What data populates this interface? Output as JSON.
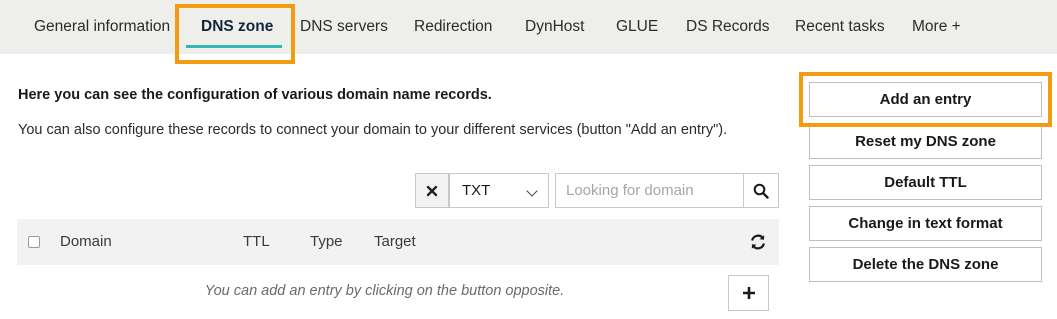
{
  "tabs": [
    {
      "label": "General information"
    },
    {
      "label": "DNS zone",
      "active": true
    },
    {
      "label": "DNS servers"
    },
    {
      "label": "Redirection"
    },
    {
      "label": "DynHost"
    },
    {
      "label": "GLUE"
    },
    {
      "label": "DS Records"
    },
    {
      "label": "Recent tasks"
    },
    {
      "label": "More +"
    }
  ],
  "intro": {
    "title": "Here you can see the configuration of various domain name records.",
    "description": "You can also configure these records to connect your domain to your different services (button \"Add an entry\")."
  },
  "filter": {
    "clear_icon": "close-icon",
    "type_value": "TXT",
    "search_placeholder": "Looking for domain",
    "search_icon": "search-icon"
  },
  "table": {
    "columns": [
      "Domain",
      "TTL",
      "Type",
      "Target"
    ],
    "refresh_icon": "refresh-icon",
    "empty_message": "You can add an entry by clicking on the button opposite.",
    "add_icon": "plus-icon"
  },
  "actions": [
    {
      "label": "Add an entry"
    },
    {
      "label": "Reset my DNS zone"
    },
    {
      "label": "Default TTL"
    },
    {
      "label": "Change in text format"
    },
    {
      "label": "Delete the DNS zone"
    }
  ],
  "colors": {
    "highlight": "#f39c12",
    "active_tab_underline": "#2fb8b5",
    "tabbar_bg": "#eeeeea"
  }
}
